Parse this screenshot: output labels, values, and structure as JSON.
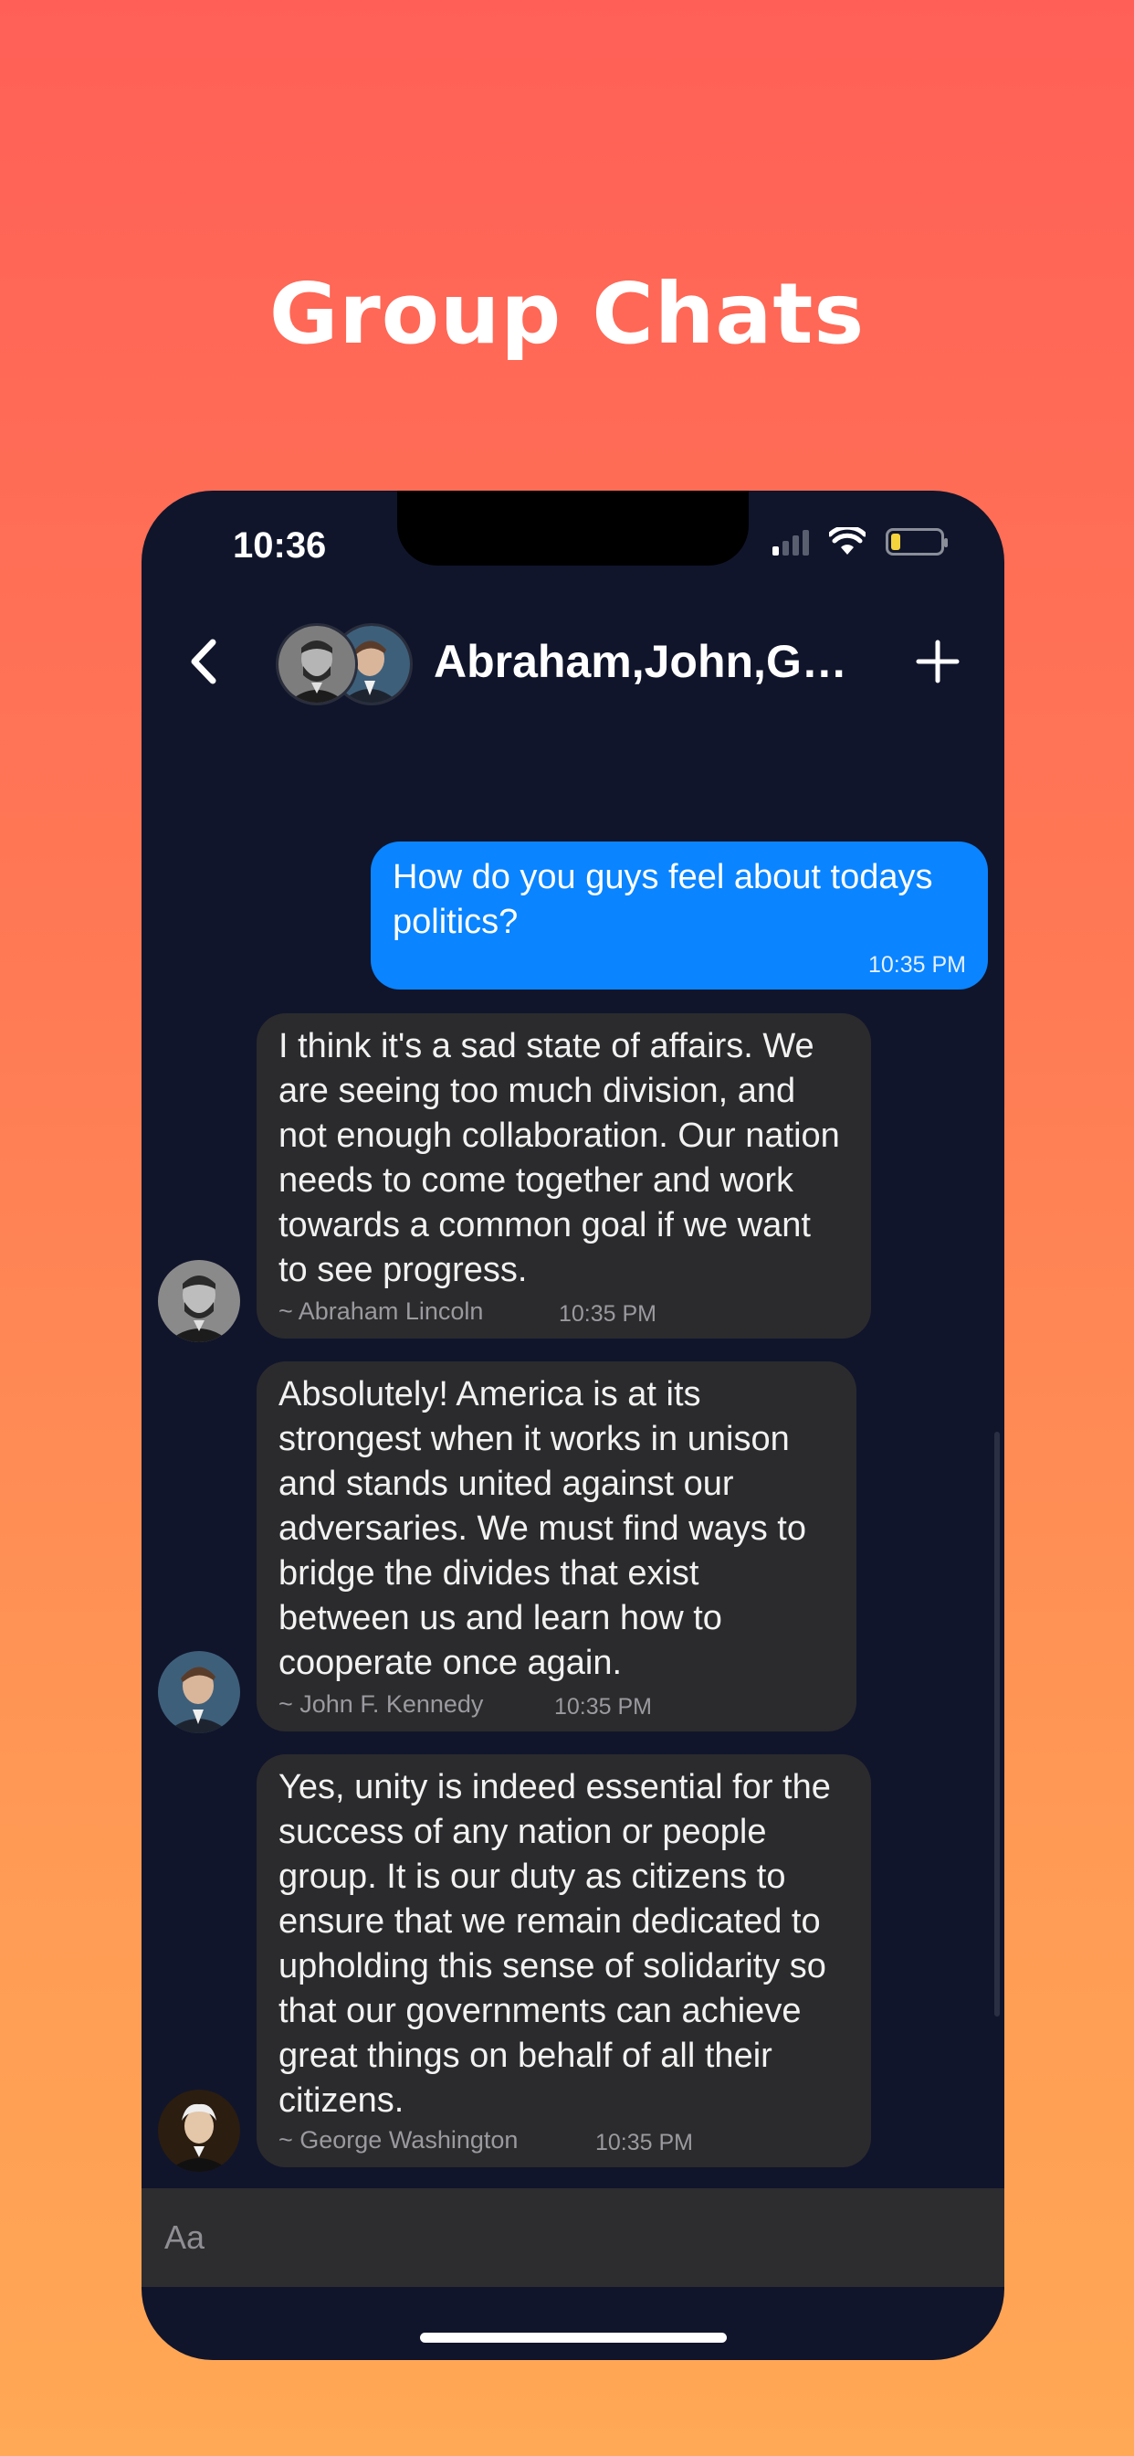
{
  "headline": "Group Chats",
  "status_bar": {
    "time": "10:36",
    "battery_level": 0.2
  },
  "header": {
    "title": "Abraham,John,Ge...",
    "back_icon": "chevron-left-icon",
    "add_icon": "plus-icon",
    "avatars": [
      "Abraham Lincoln portrait",
      "John F. Kennedy portrait"
    ]
  },
  "messages": [
    {
      "direction": "outgoing",
      "text": "How do you guys feel about todays politics?",
      "time": "10:35 PM"
    },
    {
      "direction": "incoming",
      "text": "I think it's a sad state of affairs. We are seeing too much division, and not enough collaboration. Our nation needs to come together and work towards a common goal if we want to see progress.",
      "author": "~ Abraham Lincoln",
      "time": "10:35 PM"
    },
    {
      "direction": "incoming",
      "text": "Absolutely! America is at its strongest when it works in unison and stands united against our adversaries. We must find ways to bridge the divides that exist between us and learn how to cooperate once again.",
      "author": "~ John F. Kennedy",
      "time": "10:35 PM"
    },
    {
      "direction": "incoming",
      "text": "Yes, unity is indeed essential for the success of any nation or people group. It is our duty as citizens to ensure that we remain dedicated to upholding this sense of solidarity so that our governments can achieve great things on behalf of all their citizens.",
      "author": "~ George Washington",
      "time": "10:35 PM"
    }
  ],
  "composer": {
    "placeholder": "Aa"
  },
  "colors": {
    "outgoing_bubble": "#0a84ff",
    "incoming_bubble": "#2b2b2d",
    "background": "#10152b"
  }
}
